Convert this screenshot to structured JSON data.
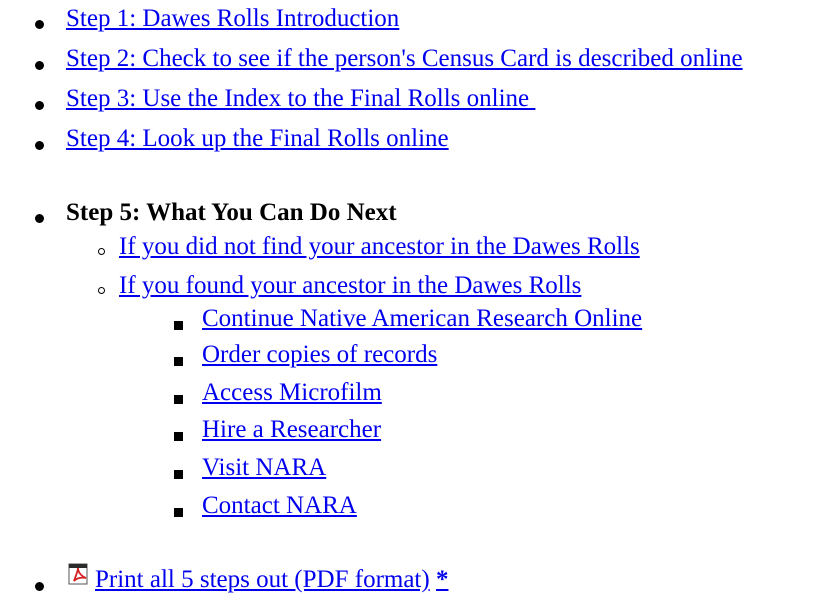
{
  "steps": [
    {
      "label": "Step 1: Dawes Rolls Introduction"
    },
    {
      "label": "Step 2: Check to see if the person's Census Card is described online"
    },
    {
      "label": "Step 3: Use the Index to the Final Rolls online "
    },
    {
      "label": "Step 4: Look up the Final Rolls online"
    }
  ],
  "step5": {
    "heading": "Step 5: What You Can Do Next",
    "sub": [
      {
        "label": "If you did not find your ancestor in the Dawes Rolls"
      },
      {
        "label": "If you found your ancestor in the Dawes Rolls"
      }
    ],
    "found_options": [
      {
        "label": "Continue Native American Research Online"
      },
      {
        "label": "Order copies of records"
      },
      {
        "label": "Access Microfilm"
      },
      {
        "label": "Hire a Researcher"
      },
      {
        "label": "Visit NARA"
      },
      {
        "label": "Contact NARA"
      }
    ]
  },
  "print": {
    "label": "Print all 5 steps out (PDF format)",
    "asterisk": "*",
    "icon": "pdf-icon"
  },
  "colors": {
    "link": "#0000ee",
    "text": "#000000",
    "pdf_red": "#d42020"
  }
}
